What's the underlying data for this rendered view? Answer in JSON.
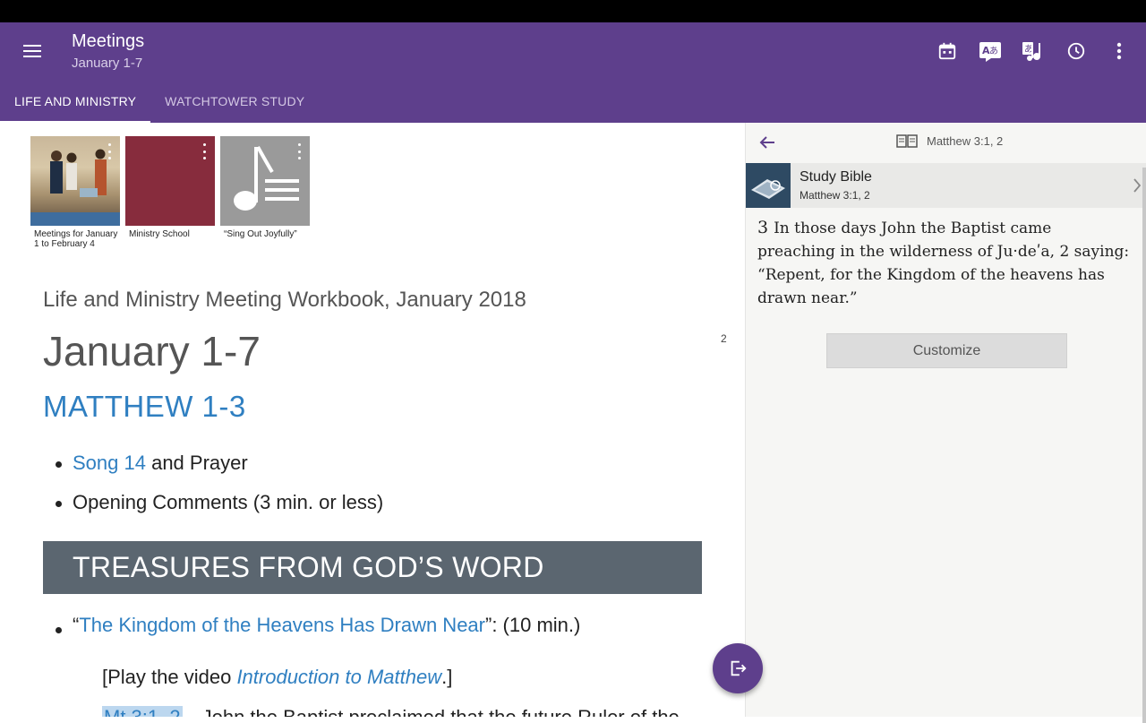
{
  "app_bar": {
    "title": "Meetings",
    "subtitle": "January 1-7",
    "bg_color": "#5e3f8c",
    "menu_icon": "menu-icon",
    "actions": [
      "calendar-icon",
      "translate-icon",
      "language-music-icon",
      "history-icon",
      "more-vert-icon"
    ]
  },
  "tabs": [
    {
      "label": "LIFE AND MINISTRY",
      "active": true
    },
    {
      "label": "WATCHTOWER STUDY",
      "active": false
    }
  ],
  "thumbnails": [
    {
      "label": "Meetings for January 1 to February 4"
    },
    {
      "label": "Ministry School"
    },
    {
      "label": "“Sing Out Joyfully”"
    }
  ],
  "content": {
    "workbook": "Life and Ministry Meeting Workbook, January 2018",
    "page_number": "2",
    "week": "January 1-7",
    "bible_reading": "MATTHEW 1-3",
    "bullet1_link": "Song 14",
    "bullet1_rest": " and Prayer",
    "bullet2": "Opening Comments (3 min. or less)",
    "section_banner": "TREASURES FROM GOD’S WORD",
    "talk_open": "“",
    "talk_link": "The Kingdom of the Heavens Has Drawn Near",
    "talk_rest": "”: (10 min.)",
    "video_prefix": "[Play the video ",
    "video_title": "Introduction to Matthew",
    "video_suffix": ".]",
    "cut_ref": "Mt 3:1, 2",
    "cut_text": "—John the Baptist proclaimed that the future Ruler of the"
  },
  "right_panel": {
    "reference": "Matthew 3:1, 2",
    "study_bible_title": "Study Bible",
    "study_bible_sub": "Matthew 3:1, 2",
    "verse_num": "3",
    "verse_text": "In those days John the Baptist came preaching in the wilderness of Ju·deʹa, 2 saying: “Repent, for the Kingdom of the heavens has drawn near.”",
    "customize_label": "Customize"
  }
}
